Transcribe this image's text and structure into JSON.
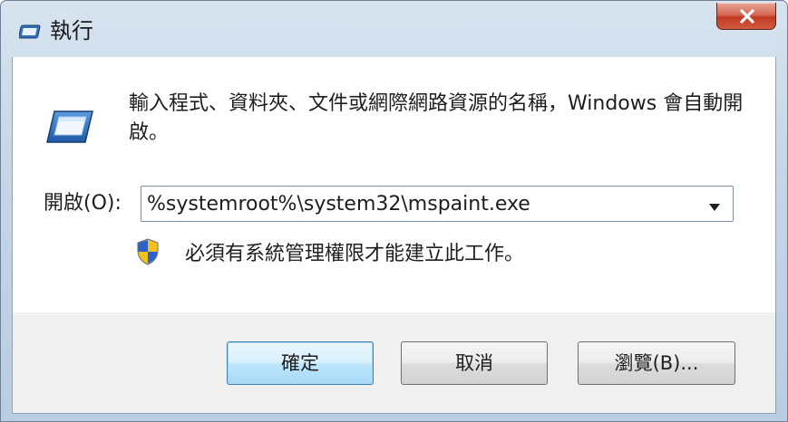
{
  "window": {
    "title": "執行",
    "close_label": "x"
  },
  "content": {
    "description": "輸入程式、資料夾、文件或網際網路資源的名稱，Windows 會自動開啟。",
    "open_label": "開啟(O):",
    "open_value": "%systemroot%\\system32\\mspaint.exe",
    "admin_note": "必須有系統管理權限才能建立此工作。"
  },
  "buttons": {
    "ok": "確定",
    "cancel": "取消",
    "browse": "瀏覽(B)..."
  },
  "icons": {
    "title": "run-icon",
    "main": "run-icon",
    "shield": "uac-shield-icon",
    "dropdown": "chevron-down-icon",
    "close": "close-icon"
  },
  "colors": {
    "accent": "#3c7fb1",
    "close_button": "#c23a23",
    "footer_background": "#f0f0f0"
  }
}
